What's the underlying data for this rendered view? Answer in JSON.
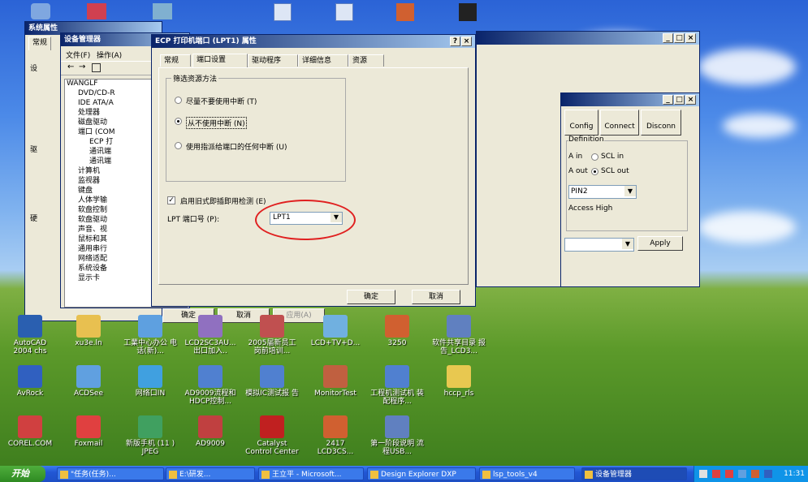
{
  "system_props": {
    "title": "系统属性",
    "tab1": "常规",
    "group1": "设",
    "group2": "驱",
    "group3": "硬",
    "btn1": "确定",
    "btn2": "取消",
    "btn3": "应用(A)"
  },
  "device_manager": {
    "title": "设备管理器",
    "menu": [
      "文件(F)",
      "操作(A)"
    ],
    "tree": [
      "WANGLF",
      "DVD/CD-R",
      "IDE ATA/A",
      "处理器",
      "磁盘驱动",
      "端口 (COM",
      "ECP 打",
      "通讯端",
      "通讯端",
      "计算机",
      "监视器",
      "键盘",
      "人体学输",
      "软盘控制",
      "软盘驱动",
      "声音、视",
      "鼠标和其",
      "通用串行",
      "网络适配",
      "系统设备",
      "显示卡"
    ]
  },
  "ecp_dialog": {
    "title": "ECP 打印机端口 (LPT1) 属性",
    "help_btn": "?",
    "close_btn": "×",
    "tabs": [
      "常规",
      "端口设置",
      "驱动程序",
      "详细信息",
      "资源"
    ],
    "group_title": "筛选资源方法",
    "options": [
      {
        "label": "尽量不要使用中断 (T)",
        "selected": false
      },
      {
        "label": "从不使用中断 (N)",
        "selected": true
      },
      {
        "label": "使用指派给端口的任何中断 (U)",
        "selected": false
      }
    ],
    "checkbox_label": "启用旧式即插即用检测 (E)",
    "checkbox_checked": true,
    "lpt_label": "LPT 端口号 (P):",
    "lpt_value": "LPT1",
    "ok": "确定",
    "cancel": "取消"
  },
  "right_window": {
    "buttons": [
      "Config",
      "Connect",
      "Disconn"
    ],
    "group_title": "Definition",
    "radios": [
      {
        "label": "SCL in",
        "prefix": "A in",
        "selected": false
      },
      {
        "label": "SCL out",
        "prefix": "A out",
        "selected": true
      }
    ],
    "pin_value": "PIN2",
    "active_label": "Access High",
    "apply": "Apply"
  },
  "desktop_icons": [
    {
      "label": "AutoCAD 2004 chs",
      "color": "#2a5fb0"
    },
    {
      "label": "xu3e.ln",
      "color": "#e8c050"
    },
    {
      "label": "工業中心办公 电话(新)...",
      "color": "#5ea0e0"
    },
    {
      "label": "LCD2SC3AU... 出口加入..",
      "color": "#9070c0"
    },
    {
      "label": "2005届新员工 岗前培训...",
      "color": "#c05050"
    },
    {
      "label": "LCD+TV+D...",
      "color": "#70b0e0"
    },
    {
      "label": "3250",
      "color": "#d06030"
    },
    {
      "label": "软件共享目录 报告_LCD3...",
      "color": "#6080c0"
    },
    {
      "label": "AvRock",
      "color": "#3060c0"
    },
    {
      "label": "ACDSee",
      "color": "#60a0e0"
    },
    {
      "label": "网络口IN",
      "color": "#40a0e0"
    },
    {
      "label": "AD9009流程和 HDCP控制...",
      "color": "#5080d0"
    },
    {
      "label": "模拟IC测试报 告",
      "color": "#5080d0"
    },
    {
      "label": "MonitorTest",
      "color": "#c06040"
    },
    {
      "label": "工程机测试机 装配程序...",
      "color": "#5080d0"
    },
    {
      "label": "hccp_rls",
      "color": "#e8c850"
    },
    {
      "label": "COREL.COM",
      "color": "#d04040"
    },
    {
      "label": "Foxmail",
      "color": "#e04040"
    },
    {
      "label": "新版手机 (11 ) JPEG",
      "color": "#40a060"
    },
    {
      "label": "AD9009",
      "color": "#c04040"
    },
    {
      "label": "Catalyst Control Center",
      "color": "#c02020"
    },
    {
      "label": "2417 LCD3CS...",
      "color": "#d06030"
    },
    {
      "label": "第一阶段说明 流程USB...",
      "color": "#6080c0"
    }
  ],
  "taskbar": {
    "start": "开始",
    "items": [
      "\"任务(任务)...",
      "E:\\研发...",
      "王立平 - Microsoft...",
      "Design Explorer DXP",
      "lsp_tools_v4",
      "设备管理器"
    ],
    "clock": "11:31"
  }
}
